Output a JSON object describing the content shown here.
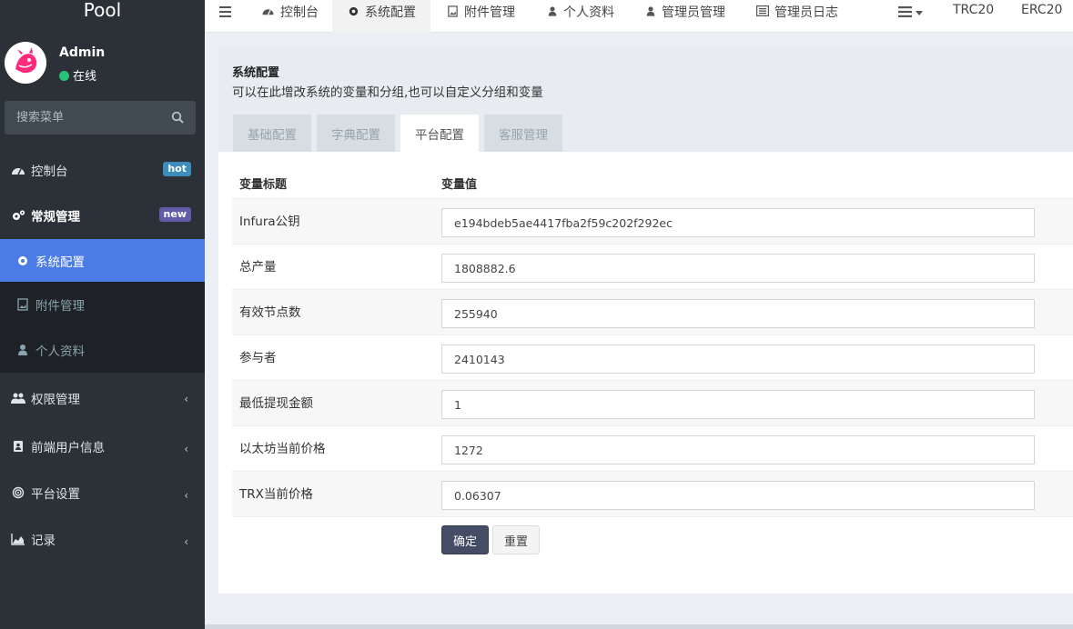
{
  "app": {
    "logo": "Pool"
  },
  "user": {
    "name": "Admin",
    "status": "在线"
  },
  "search": {
    "placeholder": "搜索菜单"
  },
  "sidebar": {
    "items": [
      {
        "label": "控制台",
        "badge": "hot"
      },
      {
        "label": "常规管理",
        "badge": "new"
      },
      {
        "label": "系统配置"
      },
      {
        "label": "附件管理"
      },
      {
        "label": "个人资料"
      },
      {
        "label": "权限管理"
      },
      {
        "label": "前端用户信息"
      },
      {
        "label": "平台设置"
      },
      {
        "label": "记录"
      }
    ]
  },
  "navbar": {
    "items": [
      "控制台",
      "系统配置",
      "附件管理",
      "个人资料",
      "管理员管理",
      "管理员日志"
    ],
    "right": [
      "TRC20",
      "ERC20"
    ]
  },
  "header": {
    "title": "系统配置",
    "description": "可以在此增改系统的变量和分组,也可以自定义分组和变量"
  },
  "tabs": [
    "基础配置",
    "字典配置",
    "平台配置",
    "客服管理"
  ],
  "table": {
    "headers": [
      "变量标题",
      "变量值"
    ],
    "rows": [
      {
        "label": "Infura公钥",
        "value": "e194bdeb5ae4417fba2f59c202f292ec"
      },
      {
        "label": "总产量",
        "value": "1808882.6"
      },
      {
        "label": "有效节点数",
        "value": "255940"
      },
      {
        "label": "参与者",
        "value": "2410143"
      },
      {
        "label": "最低提现金额",
        "value": "1"
      },
      {
        "label": "以太坊当前价格",
        "value": "1272"
      },
      {
        "label": "TRX当前价格",
        "value": "0.06307"
      }
    ]
  },
  "buttons": {
    "confirm": "确定",
    "reset": "重置"
  },
  "colors": {
    "sidebar_bg": "#2c3137",
    "active_item": "#4b7be5",
    "hot_badge": "#3c8dbc",
    "new_badge": "#605ca8",
    "confirm_btn": "#444c66"
  }
}
